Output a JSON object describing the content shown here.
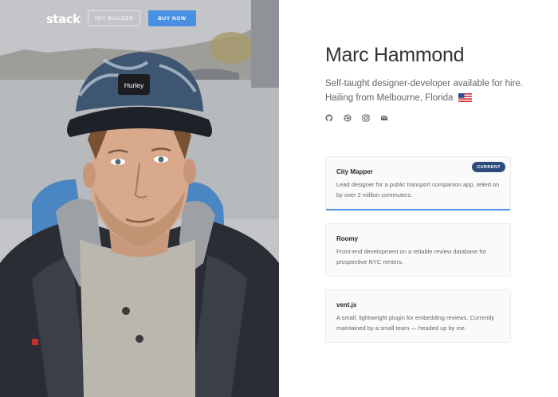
{
  "nav": {
    "logo": "stack",
    "try_builder": "TRY BUILDER",
    "buy_now": "BUY NOW"
  },
  "profile": {
    "name": "Marc Hammond",
    "bio_line1": "Self-taught designer-developer available for hire.",
    "bio_line2": "Hailing from Melbourne, Florida",
    "flag": "us-flag-icon",
    "social": [
      "github-icon",
      "dribbble-icon",
      "instagram-icon",
      "mail-icon"
    ]
  },
  "projects": [
    {
      "title": "City Mapper",
      "desc": "Lead designer for a public transport companion app, relied on by over 2 million commuters.",
      "badge": "CURRENT"
    },
    {
      "title": "Roomy",
      "desc": "Front-end development on a reliable review database for prospective NYC renters."
    },
    {
      "title": "vent.js",
      "desc": "A small, lightweight plugin for embedding reviews. Currently maintained by a small team — headed up by me."
    }
  ],
  "colors": {
    "accent": "#4a90e2",
    "badge": "#2b4b7c",
    "card_bg": "#fafafa"
  },
  "hero_image": {
    "cap_text": "Hurley"
  }
}
